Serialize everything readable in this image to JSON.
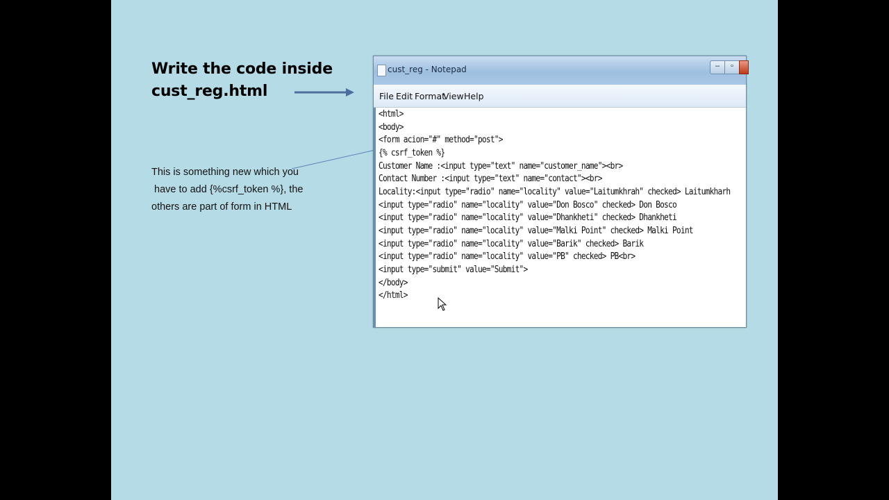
{
  "slide": {
    "heading_line1": "Write the code inside",
    "heading_line2": "cust_reg.html",
    "note_line1": "This is something new which you",
    "note_line2": " have to add {%csrf_token %}, the",
    "note_line3": "others are part of form in HTML"
  },
  "window": {
    "title": "cust_reg - Notepad",
    "menu": [
      "File",
      "Edit",
      "Format",
      "View",
      "Help"
    ],
    "icons": {
      "minimize": "minimize-icon",
      "maximize": "maximize-icon",
      "close": "close-icon"
    }
  },
  "editor": {
    "lines": [
      "<html>",
      "<body>",
      "<form acion=\"#\" method=\"post\">",
      "{% csrf_token %}",
      "Customer Name :<input type=\"text\" name=\"customer_name\"><br>",
      "Contact Number :<input type=\"text\" name=\"contact\"><br>",
      "Locality:<input type=\"radio\" name=\"locality\" value=\"Laitumkhrah\" checked> Laitumkharh",
      "<input type=\"radio\" name=\"locality\" value=\"Don Bosco\" checked> Don Bosco",
      "<input type=\"radio\" name=\"locality\" value=\"Dhankheti\" checked> Dhankheti",
      "<input type=\"radio\" name=\"locality\" value=\"Malki Point\" checked> Malki Point",
      "<input type=\"radio\" name=\"locality\" value=\"Barik\" checked> Barik",
      "<input type=\"radio\" name=\"locality\" value=\"PB\" checked> PB<br>",
      "<input type=\"submit\" value=\"Submit\">",
      "</body>",
      "</html>"
    ]
  },
  "colors": {
    "slide_bg": "#b5dce6",
    "arrow": "#4a6f9e"
  }
}
